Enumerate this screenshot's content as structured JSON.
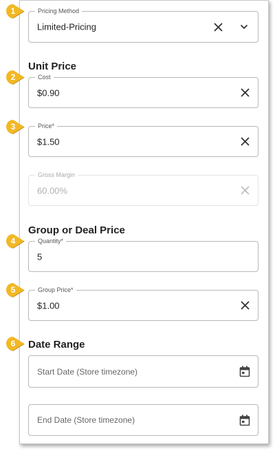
{
  "colors": {
    "badge": "#f2b824",
    "badge_shadow": "#b9870f",
    "accent_text": "#222222"
  },
  "badges": [
    "1",
    "2",
    "3",
    "4",
    "5",
    "6"
  ],
  "pricing_method": {
    "label": "Pricing Method",
    "value": "Limited-Pricing",
    "clear_icon": "close-icon",
    "dropdown_icon": "chevron-down-icon"
  },
  "unit_price": {
    "title": "Unit Price",
    "cost": {
      "label": "Cost",
      "value": "$0.90"
    },
    "price": {
      "label": "Price*",
      "value": "$1.50"
    },
    "gross_margin": {
      "label": "Gross Margin",
      "value": "60.00%"
    }
  },
  "group_price": {
    "title": "Group or Deal Price",
    "quantity": {
      "label": "Quantity*",
      "value": "5"
    },
    "group_price": {
      "label": "Group Price*",
      "value": "$1.00"
    }
  },
  "date_range": {
    "title": "Date Range",
    "start": {
      "placeholder": "Start Date (Store timezone)",
      "icon": "calendar-icon"
    },
    "end": {
      "placeholder": "End Date (Store timezone)",
      "icon": "calendar-icon"
    }
  }
}
